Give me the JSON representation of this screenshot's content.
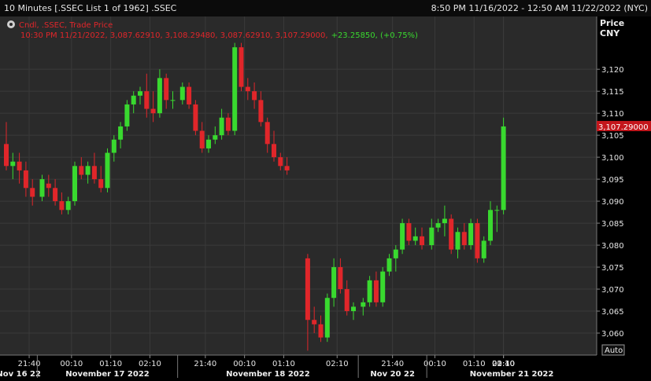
{
  "window": {
    "title": "10 Minutes [.SSEC List 1 of 1962] .SSEC",
    "date_range": "8:50 PM 11/16/2022 - 12:50 AM 11/22/2022 (NYC)"
  },
  "legend": {
    "series_label": "Cndl, .SSEC, Trade Price",
    "ohlc_line": "10:30 PM 11/21/2022, 3,087.62910, 3,108.29480, 3,087.62910, 3,107.29000,",
    "change": "+23.25850, (+0.75%)"
  },
  "axis": {
    "price_title": "Price",
    "currency": "CNY",
    "last_price_label": "3,107.29000",
    "auto_button": "Auto"
  },
  "colors": {
    "up": "#39d92f",
    "down": "#e0262a",
    "grid": "#3a3a3a",
    "background": "#2a2a2a",
    "last_price_bg": "#c4161c"
  },
  "chart_data": {
    "type": "candlestick",
    "title": "10 Minutes [.SSEC List 1 of 1962] .SSEC",
    "ylabel": "Price CNY",
    "ylim": [
      3055.0,
      3132.0
    ],
    "yticks": [
      {
        "value": 3060,
        "label": "3,060"
      },
      {
        "value": 3065,
        "label": "3,065"
      },
      {
        "value": 3070,
        "label": "3,070"
      },
      {
        "value": 3075,
        "label": "3,075"
      },
      {
        "value": 3080,
        "label": "3,080"
      },
      {
        "value": 3085,
        "label": "3,085"
      },
      {
        "value": 3090,
        "label": "3,090"
      },
      {
        "value": 3095,
        "label": "3,095"
      },
      {
        "value": 3100,
        "label": "3,100"
      },
      {
        "value": 3105,
        "label": "3,105"
      },
      {
        "value": 3110,
        "label": "3,110"
      },
      {
        "value": 3115,
        "label": "3,115"
      },
      {
        "value": 3120,
        "label": "3,120"
      }
    ],
    "xticks": [
      {
        "bar": 3.5,
        "label": "21:40"
      },
      {
        "bar": 9.5,
        "label": "00:10"
      },
      {
        "bar": 15.5,
        "label": "01:10"
      },
      {
        "bar": 21.5,
        "label": "02:10"
      },
      {
        "bar": 29.5,
        "label": "21:40"
      },
      {
        "bar": 35.5,
        "label": "00:10"
      },
      {
        "bar": 41.5,
        "label": "01:10"
      },
      {
        "bar": 47.5,
        "label": "02:10"
      },
      {
        "bar": 55.5,
        "label": "21:40"
      },
      {
        "bar": 61.5,
        "label": "00:10"
      },
      {
        "bar": 67.5,
        "label": "01:10"
      },
      {
        "bar": 73.5,
        "label": "02:10"
      },
      {
        "bar": 81.5,
        "label": "21:40"
      },
      {
        "bar": 86.5,
        "label": "00:10"
      }
    ],
    "sessions": [
      {
        "label": "Nov 16 22",
        "start": 0,
        "end": 4
      },
      {
        "label": "November 17 2022",
        "start": 5,
        "end": 25
      },
      {
        "label": "November 18 2022",
        "start": 26,
        "end": 50
      },
      {
        "label": "Nov 20 22",
        "start": 51,
        "end": 60
      },
      {
        "label": "November 21 2022",
        "start": 61,
        "end": 87
      }
    ],
    "candles": [
      [
        3103,
        3108,
        3097,
        3098
      ],
      [
        3098,
        3101,
        3095,
        3099
      ],
      [
        3099,
        3101,
        3094,
        3097
      ],
      [
        3097,
        3099,
        3091,
        3093
      ],
      [
        3093,
        3095,
        3089,
        3091
      ],
      [
        3091,
        3096,
        3090,
        3095
      ],
      [
        3094,
        3096,
        3091,
        3093
      ],
      [
        3093,
        3095,
        3089,
        3090
      ],
      [
        3090,
        3092,
        3087,
        3088
      ],
      [
        3088,
        3091,
        3087,
        3090
      ],
      [
        3090,
        3099,
        3089,
        3098
      ],
      [
        3098,
        3100,
        3095,
        3096
      ],
      [
        3096,
        3099,
        3094,
        3098
      ],
      [
        3098,
        3101,
        3094,
        3095
      ],
      [
        3095,
        3098,
        3092,
        3093
      ],
      [
        3093,
        3102,
        3092,
        3101
      ],
      [
        3101,
        3105,
        3099,
        3104
      ],
      [
        3104,
        3108,
        3102,
        3107
      ],
      [
        3107,
        3113,
        3106,
        3112
      ],
      [
        3112,
        3115,
        3110,
        3114
      ],
      [
        3114,
        3116,
        3112,
        3115
      ],
      [
        3115,
        3119,
        3109,
        3111
      ],
      [
        3111,
        3115,
        3108,
        3110
      ],
      [
        3110,
        3120,
        3109,
        3118
      ],
      [
        3118,
        3119,
        3111,
        3113
      ],
      [
        3113,
        3115,
        3111,
        3113
      ],
      [
        3113,
        3117,
        3112,
        3116
      ],
      [
        3116,
        3117,
        3111,
        3112
      ],
      [
        3112,
        3113,
        3105,
        3106
      ],
      [
        3106,
        3108,
        3101,
        3102
      ],
      [
        3102,
        3105,
        3101,
        3104
      ],
      [
        3104,
        3107,
        3103,
        3105
      ],
      [
        3105,
        3111,
        3104,
        3109
      ],
      [
        3109,
        3110,
        3105,
        3106
      ],
      [
        3106,
        3126,
        3105,
        3125
      ],
      [
        3125,
        3126,
        3115,
        3116
      ],
      [
        3116,
        3118,
        3113,
        3115
      ],
      [
        3115,
        3117,
        3111,
        3113
      ],
      [
        3113,
        3115,
        3107,
        3108
      ],
      [
        3108,
        3109,
        3101,
        3103
      ],
      [
        3103,
        3106,
        3099,
        3100
      ],
      [
        3100,
        3101,
        3097,
        3098
      ],
      [
        3098,
        3100,
        3096,
        3097
      ],
      [
        3077,
        3078,
        3056,
        3063
      ],
      [
        3063,
        3066,
        3060,
        3062
      ],
      [
        3062,
        3064,
        3058,
        3059
      ],
      [
        3059,
        3069,
        3058,
        3068
      ],
      [
        3068,
        3077,
        3066,
        3075
      ],
      [
        3075,
        3077,
        3069,
        3070
      ],
      [
        3070,
        3072,
        3064,
        3065
      ],
      [
        3065,
        3067,
        3063,
        3066
      ],
      [
        3066,
        3068,
        3064,
        3067
      ],
      [
        3067,
        3073,
        3066,
        3072
      ],
      [
        3072,
        3074,
        3066,
        3067
      ],
      [
        3067,
        3075,
        3066,
        3074
      ],
      [
        3074,
        3078,
        3073,
        3077
      ],
      [
        3077,
        3080,
        3074,
        3079
      ],
      [
        3079,
        3086,
        3078,
        3085
      ],
      [
        3085,
        3086,
        3080,
        3081
      ],
      [
        3081,
        3084,
        3080,
        3082
      ],
      [
        3082,
        3084,
        3079,
        3080
      ],
      [
        3080,
        3086,
        3079,
        3084
      ],
      [
        3084,
        3086,
        3083,
        3085
      ],
      [
        3085,
        3089,
        3082,
        3086
      ],
      [
        3086,
        3087,
        3078,
        3079
      ],
      [
        3079,
        3084,
        3077,
        3083
      ],
      [
        3083,
        3085,
        3079,
        3080
      ],
      [
        3080,
        3086,
        3079,
        3085
      ],
      [
        3085,
        3086,
        3076,
        3077
      ],
      [
        3077,
        3082,
        3076,
        3081
      ],
      [
        3081,
        3090,
        3080,
        3088
      ],
      [
        3088,
        3089,
        3083,
        3088
      ],
      [
        3088,
        3109,
        3087,
        3107
      ]
    ]
  }
}
